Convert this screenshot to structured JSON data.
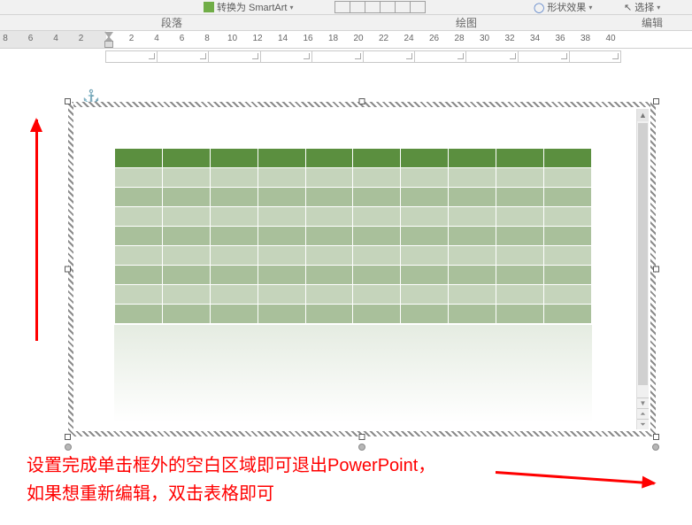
{
  "ribbon": {
    "smartart_label": "转换为 SmartArt",
    "shape_effect_label": "形状效果",
    "select_label": "选择"
  },
  "sections": {
    "paragraph": "段落",
    "drawing": "绘图",
    "edit": "编辑"
  },
  "ruler": {
    "left_values": [
      "8",
      "6",
      "4",
      "2"
    ],
    "right_values": [
      "2",
      "4",
      "6",
      "8",
      "10",
      "12",
      "14",
      "16",
      "18",
      "20",
      "22",
      "24",
      "26",
      "28",
      "30",
      "32",
      "34",
      "36",
      "38",
      "40"
    ]
  },
  "chart_data": {
    "type": "table",
    "columns": 10,
    "rows": 9,
    "header_color": "#5b8f3f",
    "banded_colors": [
      "#c5d4bb",
      "#a9c09b"
    ],
    "has_reflection": true
  },
  "annotation": {
    "line1": "设置完成单击框外的空白区域即可退出PowerPoint，",
    "line2": "如果想重新编辑，双击表格即可"
  },
  "anchor_symbol": "⚓"
}
